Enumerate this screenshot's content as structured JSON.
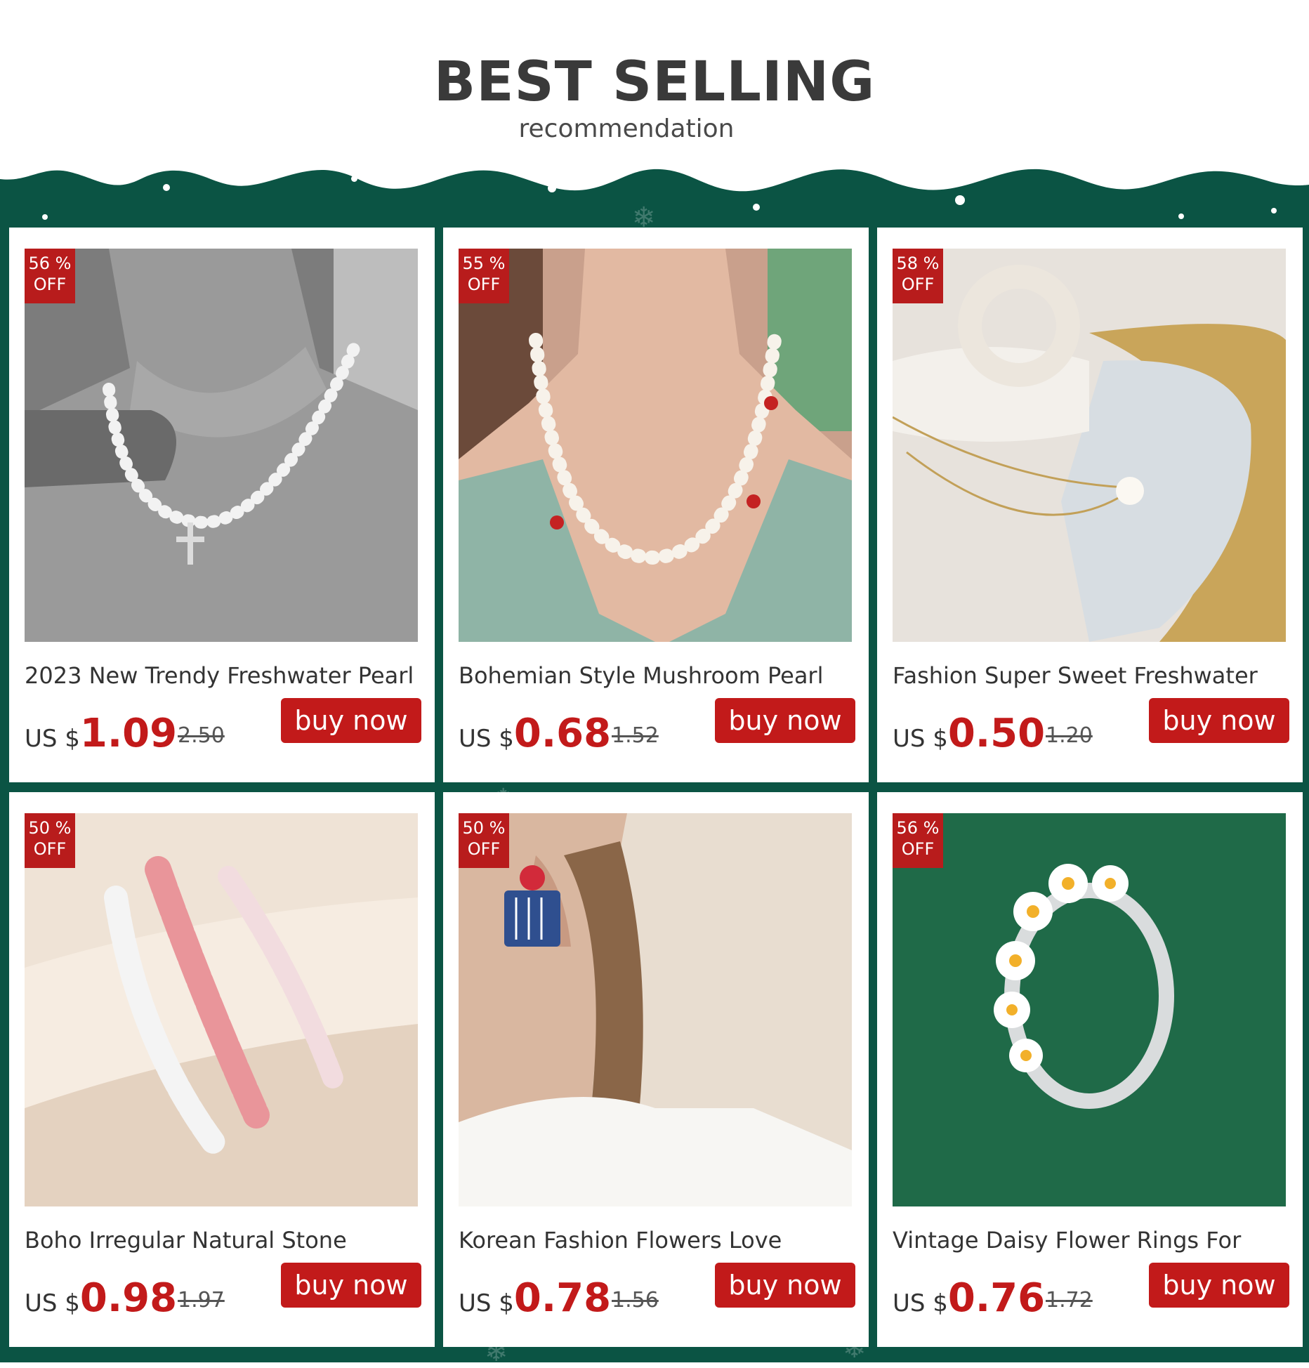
{
  "header": {
    "title": "BEST SELLING",
    "subtitle": "recommendation"
  },
  "colors": {
    "background_green": "#0b5444",
    "accent_red": "#c21a1a",
    "badge_red": "#b81c1c"
  },
  "products": [
    {
      "discount_pct": "56 %",
      "discount_off": "OFF",
      "name": "2023 New Trendy Freshwater Pearl",
      "currency": "US $",
      "price": "1.09",
      "original_price": "2.50",
      "button": "buy now",
      "image": "pearl-cross-necklace-photo"
    },
    {
      "discount_pct": "55 %",
      "discount_off": "OFF",
      "name": "Bohemian Style Mushroom Pearl",
      "currency": "US $",
      "price": "0.68",
      "original_price": "1.52",
      "button": "buy now",
      "image": "mushroom-pearl-necklace-photo"
    },
    {
      "discount_pct": "58 %",
      "discount_off": "OFF",
      "name": "Fashion Super Sweet Freshwater",
      "currency": "US $",
      "price": "0.50",
      "original_price": "1.20",
      "button": "buy now",
      "image": "pearl-pendant-chain-photo"
    },
    {
      "discount_pct": "50 %",
      "discount_off": "OFF",
      "name": "Boho Irregular Natural Stone",
      "currency": "US $",
      "price": "0.98",
      "original_price": "1.97",
      "button": "buy now",
      "image": "natural-stone-bracelets-photo"
    },
    {
      "discount_pct": "50 %",
      "discount_off": "OFF",
      "name": "Korean Fashion Flowers Love",
      "currency": "US $",
      "price": "0.78",
      "original_price": "1.56",
      "button": "buy now",
      "image": "flower-earring-photo"
    },
    {
      "discount_pct": "56 %",
      "discount_off": "OFF",
      "name": "Vintage Daisy Flower Rings For",
      "currency": "US $",
      "price": "0.76",
      "original_price": "1.72",
      "button": "buy now",
      "image": "daisy-ring-photo"
    }
  ]
}
